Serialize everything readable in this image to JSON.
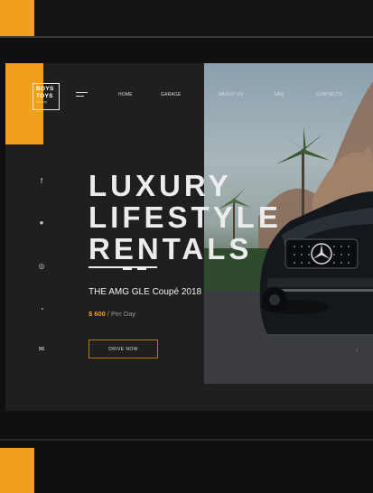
{
  "brand": {
    "logo_line1": "BOYS",
    "logo_line2": "TOYS",
    "logo_sub": "Luxury"
  },
  "nav": {
    "items": [
      {
        "label": "HOME"
      },
      {
        "label": "GARAGE"
      },
      {
        "label": "ABOUT US"
      },
      {
        "label": "FAQ"
      },
      {
        "label": "CONTACTS"
      }
    ]
  },
  "social": [
    {
      "icon": "facebook-icon",
      "glyph": "f"
    },
    {
      "icon": "messenger-icon",
      "glyph": "●"
    },
    {
      "icon": "instagram-icon",
      "glyph": "◎"
    },
    {
      "icon": "whatsapp-icon",
      "glyph": "◔"
    },
    {
      "icon": "mail-icon",
      "glyph": "✉"
    }
  ],
  "hero": {
    "line1": "LUXURY",
    "line2": "LIFESTYLE",
    "line3": "RENTALS"
  },
  "car": {
    "model": "THE AMG GLE Coupé 2018",
    "price": "$ 600",
    "price_unit": " / Per Day"
  },
  "cta": {
    "label": "DRIVE NOW"
  },
  "colors": {
    "accent": "#f0a01c",
    "card_bg": "#1f1f1f",
    "page_bg": "#101010"
  }
}
